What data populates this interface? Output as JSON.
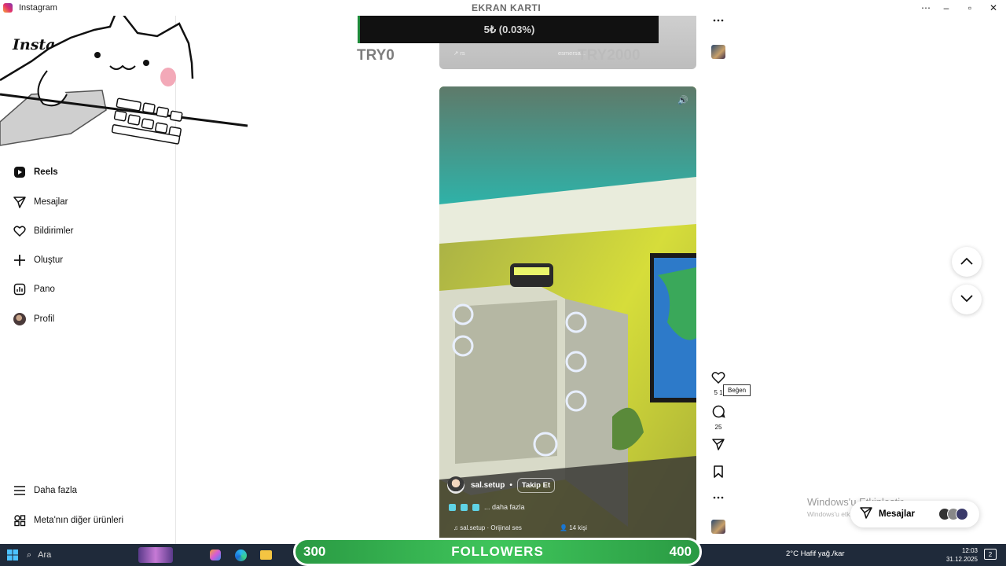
{
  "window": {
    "title": "Instagram"
  },
  "sidebar": {
    "logo": "Instagram",
    "items": [
      {
        "label": "Reels",
        "icon": "reels-icon"
      },
      {
        "label": "Mesajlar",
        "icon": "paper-plane-icon"
      },
      {
        "label": "Bildirimler",
        "icon": "heart-icon"
      },
      {
        "label": "Oluştur",
        "icon": "plus-icon"
      },
      {
        "label": "Pano",
        "icon": "dashboard-icon"
      },
      {
        "label": "Profil",
        "icon": "avatar"
      },
      {
        "label": "Daha fazla",
        "icon": "menu-icon"
      },
      {
        "label": "Meta'nın diğer ürünleri",
        "icon": "meta-products-icon"
      }
    ]
  },
  "stream_overlay": {
    "header": "EKRAN KARTI",
    "price_text": "5₺ (0.03%)",
    "left_label": "TRY0",
    "right_label": "TRY2000",
    "followers_from": "300",
    "followers_label": "FOLLOWERS",
    "followers_to": "400"
  },
  "previous_reel": {
    "meta_left": "↗ rs",
    "meta_right": "esmersa..."
  },
  "reel": {
    "username": "sal.setup",
    "follow_label": "Takip Et",
    "caption_more": "... daha fazla",
    "audio": "sal.setup · Orijinal ses",
    "people": "14 kişi"
  },
  "actions": {
    "likes": "5 1",
    "like_tooltip": "Beğen",
    "comments": "25"
  },
  "windows_activation": {
    "title": "Windows'u Etkinleştir",
    "subtitle": "Windows'u etk... Ayarlar"
  },
  "messages_pill": {
    "label": "Mesajlar"
  },
  "taskbar": {
    "search": "Ara",
    "weather": "2°C Hafif yağ./kar",
    "time": "12:03",
    "date": "31.12.2025",
    "notifications": "2"
  },
  "colors": {
    "followers_bar": "#3fc55b",
    "taskbar": "#1f2a3a",
    "stock_bar": "#111111"
  }
}
